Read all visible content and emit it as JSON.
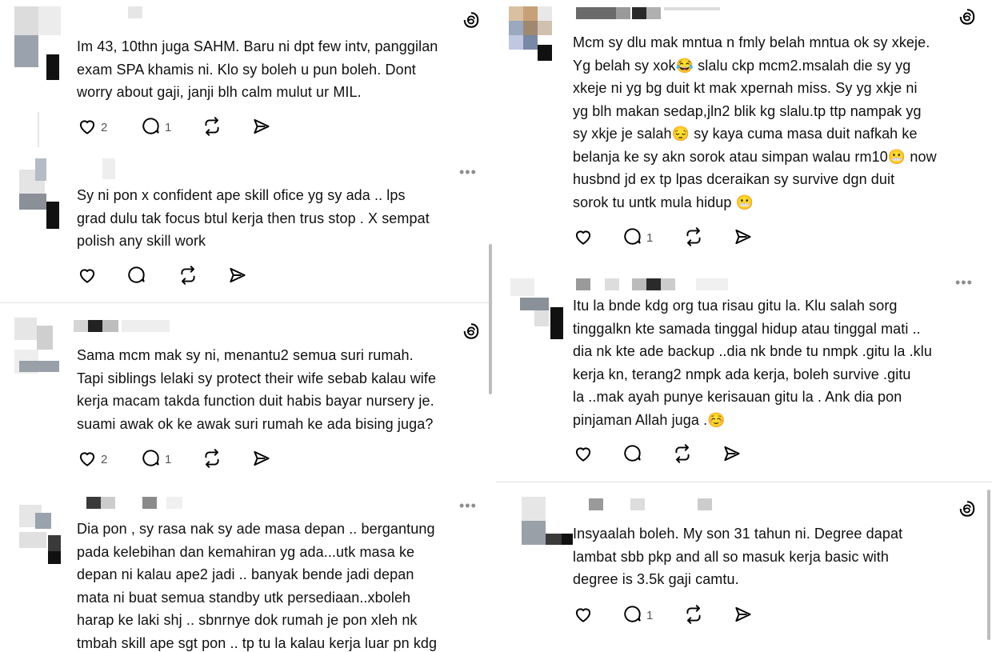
{
  "left_posts": [
    {
      "lines": [
        "Im 43, 10thn juga SAHM. Baru ni dpt few intv, panggilan",
        "exam SPA khamis ni. Klo sy boleh u pun boleh. Dont",
        "worry about gaji, janji blh calm mulut ur MIL."
      ],
      "likes": "2",
      "replies": "1",
      "top_icon": "threads-logo-icon"
    },
    {
      "lines": [
        "Sy ni pon x confident ape skill ofice yg sy ada .. lps",
        "grad dulu tak focus btul kerja then trus stop . X sempat",
        "polish any skill work"
      ],
      "likes": "",
      "replies": "",
      "top_icon": "more-dots-icon"
    },
    {
      "lines": [
        "Sama mcm mak sy ni, menantu2 semua suri rumah.",
        "Tapi siblings lelaki sy protect their wife sebab kalau wife",
        "kerja macam takda function duit habis bayar nursery je.",
        "suami awak ok ke awak suri rumah ke ada bising juga?"
      ],
      "likes": "2",
      "replies": "1",
      "top_icon": "threads-logo-icon"
    },
    {
      "lines": [
        "Dia pon , sy rasa nak sy ade masa depan .. bergantung",
        "pada kelebihan dan kemahiran yg ada...utk masa ke",
        "depan ni kalau ape2 jadi .. banyak bende jadi depan",
        "mata ni buat semua standby utk persediaan..xboleh",
        "harap ke laki shj .. sbnrnye dok rumah je pon xleh nk",
        "tmbah skill ape sgt pon .. tp tu la kalau kerja luar pn kdg"
      ],
      "likes": "",
      "replies": "",
      "top_icon": "more-dots-icon"
    }
  ],
  "right_posts": [
    {
      "lines": [
        "Mcm sy dlu mak mntua n fmly belah mntua ok sy xkeje.",
        "Yg belah sy xok😂 slalu ckp mcm2.msalah die sy yg",
        "xkeje ni yg bg duit kt mak xpernah miss. Sy yg xkje ni",
        "yg blh makan sedap,jln2 blik kg slalu.tp ttp nampak yg",
        "sy xkje je salah😔 sy kaya cuma masa duit nafkah ke",
        "belanja ke sy akn sorok atau simpan walau rm10😬 now",
        "husbnd jd ex tp lpas dceraikan sy survive dgn duit",
        "sorok tu untk mula hidup 😬"
      ],
      "likes": "",
      "replies": "1",
      "top_icon": "threads-logo-icon"
    },
    {
      "lines": [
        "Itu la bnde kdg org tua risau gitu la.  Klu salah sorg",
        "tinggalkn kte samada tinggal hidup atau tinggal mati ..",
        "dia nk kte ade backup ..dia nk bnde tu nmpk .gitu la .klu",
        "kerja kn, terang2 nmpk ada kerja, boleh survive .gitu",
        "la ..mak ayah punye kerisauan gitu la . Ank dia pon",
        "pinjaman Allah juga .☺️"
      ],
      "likes": "",
      "replies": "",
      "top_icon": "more-dots-icon"
    },
    {
      "lines": [
        "Insyaalah boleh. My son 31 tahun ni. Degree dapat",
        "lambat sbb pkp and all so masuk kerja basic with",
        "degree is 3.5k gaji camtu."
      ],
      "likes": "",
      "replies": "1",
      "top_icon": "threads-logo-icon"
    }
  ],
  "more_label": "•••"
}
